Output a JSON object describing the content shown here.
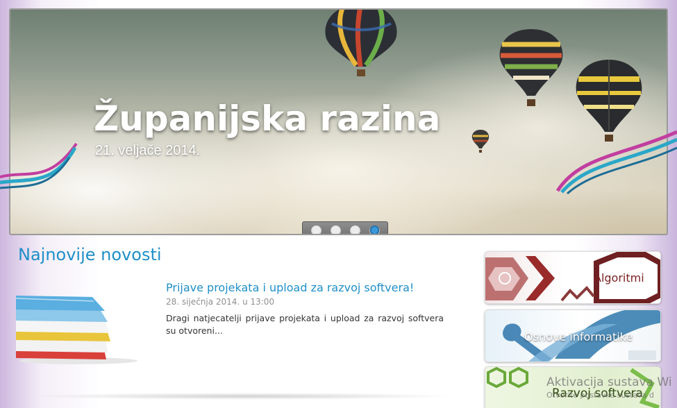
{
  "slider": {
    "title": "Županijska razina",
    "date": "21. veljače 2014.",
    "pager": {
      "count": 4,
      "active": 4
    }
  },
  "news": {
    "section_title": "Najnovije novosti",
    "items": [
      {
        "title": "Prijave projekata i upload za razvoj softvera!",
        "date": "28. siječnja 2014. u 13:00",
        "excerpt": "Dragi natjecatelji prijave projekata i upload za razvoj softvera su otvoreni..."
      }
    ]
  },
  "sidebar": {
    "banners": [
      {
        "label": "Algoritmi",
        "color": "#7a1f22"
      },
      {
        "label": "Osnove informatike",
        "color": "#ffffff"
      },
      {
        "label": "Razvoj softvera",
        "color": "#2e4a10"
      }
    ]
  },
  "watermark": {
    "line1": "Aktivacija sustava Wi",
    "line2": "Otvorite postavke sustava d"
  }
}
